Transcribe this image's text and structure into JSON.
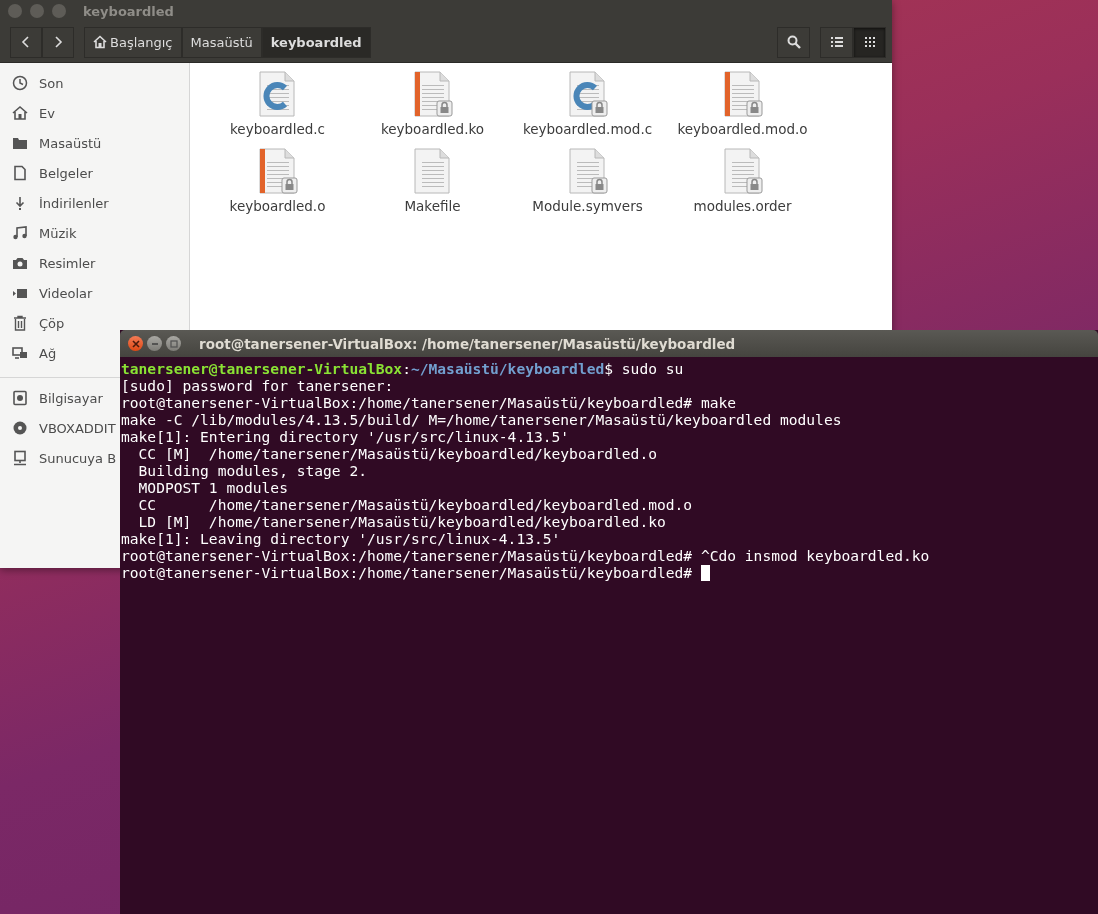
{
  "file_manager": {
    "title": "keyboardled",
    "breadcrumbs": [
      {
        "label": "Başlangıç",
        "home": true,
        "selected": false
      },
      {
        "label": "Masaüstü",
        "home": false,
        "selected": false
      },
      {
        "label": "keyboardled",
        "home": false,
        "selected": true
      }
    ],
    "views": [
      {
        "kind": "list",
        "selected": false
      },
      {
        "kind": "grid",
        "selected": true
      }
    ],
    "sidebar": {
      "groups": [
        [
          {
            "kind": "recent",
            "label": "Son"
          },
          {
            "kind": "home",
            "label": "Ev"
          },
          {
            "kind": "folder",
            "label": "Masaüstü"
          },
          {
            "kind": "document",
            "label": "Belgeler"
          },
          {
            "kind": "download",
            "label": "İndirilenler"
          },
          {
            "kind": "music",
            "label": "Müzik"
          },
          {
            "kind": "camera",
            "label": "Resimler"
          },
          {
            "kind": "video",
            "label": "Videolar"
          },
          {
            "kind": "trash",
            "label": "Çöp"
          },
          {
            "kind": "network",
            "label": "Ağ"
          }
        ],
        [
          {
            "kind": "computer",
            "label": "Bilgisayar"
          },
          {
            "kind": "disc",
            "label": "VBOXADDIT"
          },
          {
            "kind": "server",
            "label": "Sunucuya B"
          }
        ]
      ]
    },
    "files": [
      {
        "name": "keyboardled.c",
        "kind": "c",
        "locked": false
      },
      {
        "name": "keyboardled.ko",
        "kind": "binary",
        "locked": true
      },
      {
        "name": "keyboardled.mod.c",
        "kind": "c",
        "locked": true
      },
      {
        "name": "keyboardled.mod.o",
        "kind": "binary",
        "locked": true
      },
      {
        "name": "keyboardled.o",
        "kind": "binary",
        "locked": true
      },
      {
        "name": "Makefile",
        "kind": "text",
        "locked": false
      },
      {
        "name": "Module.symvers",
        "kind": "text",
        "locked": true
      },
      {
        "name": "modules.order",
        "kind": "text",
        "locked": true
      }
    ]
  },
  "terminal": {
    "title": "root@tanersener-VirtualBox: /home/tanersener/Masaüstü/keyboardled",
    "cursor": true,
    "lines": [
      [
        {
          "kind": "user",
          "text": "tanersener@tanersener-VirtualBox"
        },
        {
          "kind": "plain",
          "text": ":"
        },
        {
          "kind": "path",
          "text": "~/Masaüstü/keyboardled"
        },
        {
          "kind": "plain",
          "text": "$ sudo su"
        }
      ],
      [
        {
          "kind": "plain",
          "text": "[sudo] password for tanersener:"
        }
      ],
      [
        {
          "kind": "plain",
          "text": "root@tanersener-VirtualBox:/home/tanersener/Masaüstü/keyboardled# make"
        }
      ],
      [
        {
          "kind": "plain",
          "text": "make -C /lib/modules/4.13.5/build/ M=/home/tanersener/Masaüstü/keyboardled modules"
        }
      ],
      [
        {
          "kind": "plain",
          "text": "make[1]: Entering directory '/usr/src/linux-4.13.5'"
        }
      ],
      [
        {
          "kind": "plain",
          "text": "  CC [M]  /home/tanersener/Masaüstü/keyboardled/keyboardled.o"
        }
      ],
      [
        {
          "kind": "plain",
          "text": "  Building modules, stage 2."
        }
      ],
      [
        {
          "kind": "plain",
          "text": "  MODPOST 1 modules"
        }
      ],
      [
        {
          "kind": "plain",
          "text": "  CC      /home/tanersener/Masaüstü/keyboardled/keyboardled.mod.o"
        }
      ],
      [
        {
          "kind": "plain",
          "text": "  LD [M]  /home/tanersener/Masaüstü/keyboardled/keyboardled.ko"
        }
      ],
      [
        {
          "kind": "plain",
          "text": "make[1]: Leaving directory '/usr/src/linux-4.13.5'"
        }
      ],
      [
        {
          "kind": "plain",
          "text": "root@tanersener-VirtualBox:/home/tanersener/Masaüstü/keyboardled# ^Cdo insmod keyboardled.ko"
        }
      ],
      [
        {
          "kind": "plain",
          "text": "root@tanersener-VirtualBox:/home/tanersener/Masaüstü/keyboardled# "
        }
      ]
    ]
  }
}
